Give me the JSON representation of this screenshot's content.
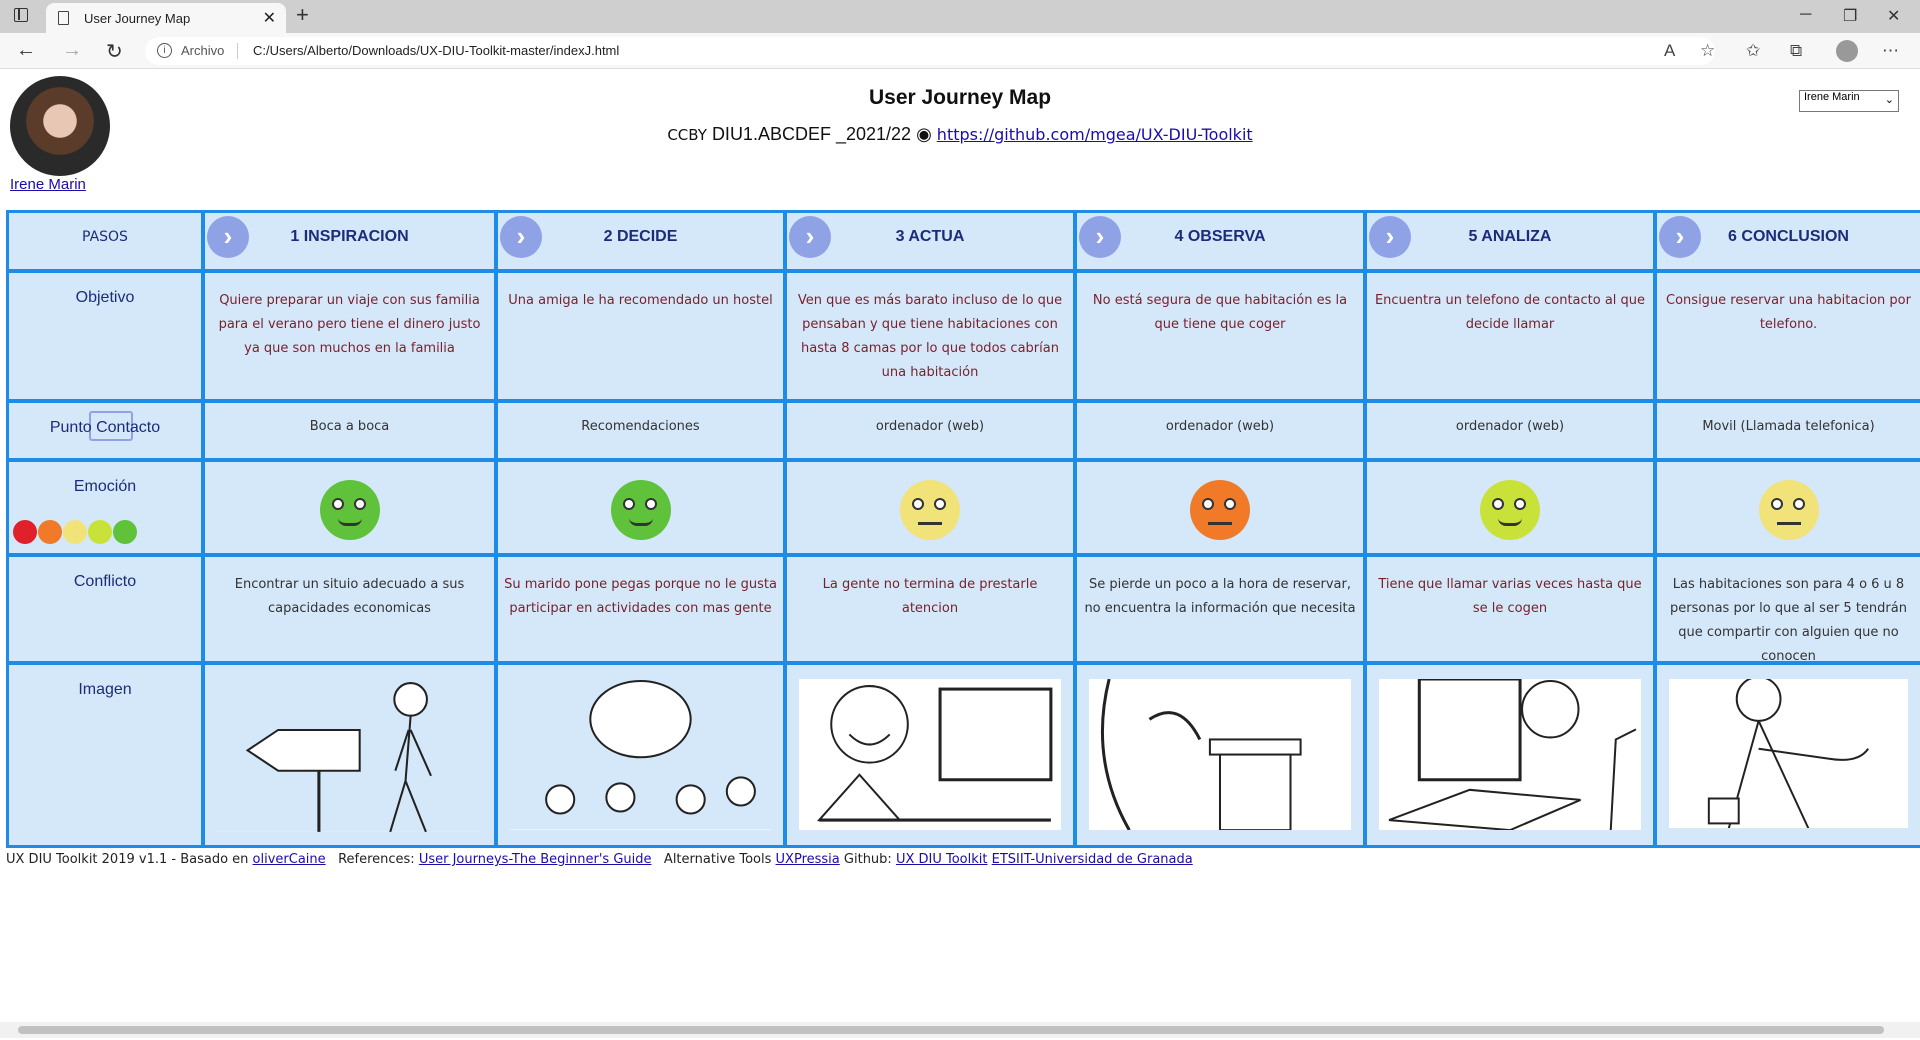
{
  "browser": {
    "tab_title": "User Journey Map",
    "address_label": "Archivo",
    "url": "C:/Users/Alberto/Downloads/UX-DIU-Toolkit-master/indexJ.html"
  },
  "header": {
    "title": "User Journey Map",
    "license": "CCBY",
    "course": "DIU1.ABCDEF _2021/22",
    "repo_link": "https://github.com/mgea/UX-DIU-Toolkit",
    "persona_name": "Irene Marin",
    "persona_select": "Irene Marin"
  },
  "journey": {
    "steps_label": "PASOS",
    "steps": [
      "1 INSPIRACION",
      "2 DECIDE",
      "3 ACTUA",
      "4 OBSERVA",
      "5 ANALIZA",
      "6 CONCLUSION"
    ],
    "rows": {
      "objetivo": {
        "label": "Objetivo",
        "values": [
          "Quiere preparar un viaje con sus familia para el verano pero tiene el dinero justo ya que son muchos en la familia",
          "Una amiga le ha recomendado un hostel",
          "Ven que es más barato incluso de lo que pensaban y que tiene habitaciones con hasta 8 camas por lo que todos cabrían una habitación",
          "No está segura de que habitación es la que tiene que coger",
          "Encuentra un telefono de contacto al que decide llamar",
          "Consigue reservar una habitacion por telefono."
        ]
      },
      "contacto": {
        "label": "Punto Contacto",
        "values": [
          "Boca a boca",
          "Recomendaciones",
          "ordenador (web)",
          "ordenador (web)",
          "ordenador (web)",
          "Movil (Llamada telefonica)"
        ]
      },
      "emocion": {
        "label": "Emoción",
        "faces": [
          "#5fc23a",
          "#5fc23a",
          "#f2e27a",
          "#f07a28",
          "#c9e23a",
          "#f2e27a"
        ]
      },
      "conflicto": {
        "label": "Conflicto",
        "values": [
          "Encontrar un situio adecuado a sus capacidades economicas",
          "Su marido pone pegas porque no le gusta participar en actividades con mas gente",
          "La gente no termina de prestarle atencion",
          "Se pierde un poco a la hora de reservar, no encuentra la información que necesita",
          "Tiene que llamar varias veces hasta que se le cogen",
          "Las habitaciones son para 4 o 6 u 8 personas por lo que al ser 5 tendrán que compartir con alguien que no conocen"
        ]
      },
      "imagen": {
        "label": "Imagen"
      }
    }
  },
  "footer": {
    "text1": "UX DIU Toolkit 2019 v1.1 - Basado en",
    "link1": "oliverCaine",
    "text2": "References:",
    "link2": "User Journeys-The Beginner's Guide",
    "text3": "Alternative Tools",
    "link3": "UXPressia",
    "text4": "Github:",
    "link4": "UX DIU Toolkit",
    "link5": "ETSIIT-Universidad de Granada"
  },
  "colors": {
    "cell_bg": "#d4e8fa",
    "cell_border": "#1e8be6",
    "header_text": "#1d2c7a",
    "content_text": "#7a1f2a"
  }
}
